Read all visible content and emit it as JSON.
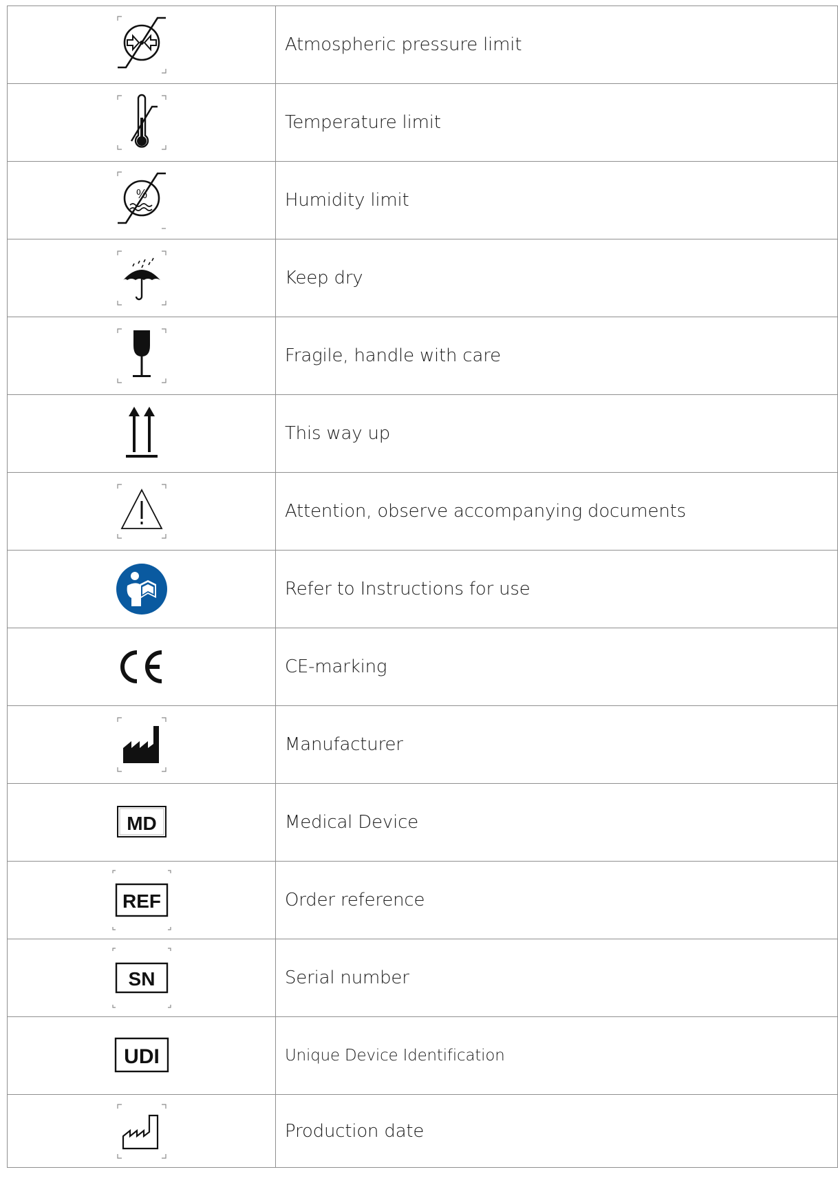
{
  "symbols": [
    {
      "icon": "atmospheric-pressure-limit-icon",
      "label": "Atmospheric pressure limit"
    },
    {
      "icon": "temperature-limit-icon",
      "label": "Temperature limit"
    },
    {
      "icon": "humidity-limit-icon",
      "label": "Humidity limit",
      "icon_text": "%"
    },
    {
      "icon": "keep-dry-icon",
      "label": "Keep dry"
    },
    {
      "icon": "fragile-icon",
      "label": "Fragile, handle with care"
    },
    {
      "icon": "this-way-up-icon",
      "label": "This way up"
    },
    {
      "icon": "caution-icon",
      "label": "Attention, observe accompanying documents"
    },
    {
      "icon": "instructions-for-use-icon",
      "label": "Refer to Instructions for use"
    },
    {
      "icon": "ce-marking-icon",
      "label": "CE-marking",
      "icon_text": "CE"
    },
    {
      "icon": "manufacturer-icon",
      "label": "Manufacturer"
    },
    {
      "icon": "medical-device-icon",
      "label": "Medical Device",
      "icon_text": "MD"
    },
    {
      "icon": "order-reference-icon",
      "label": "Order reference",
      "icon_text": "REF"
    },
    {
      "icon": "serial-number-icon",
      "label": "Serial number",
      "icon_text": "SN"
    },
    {
      "icon": "udi-icon",
      "label": "Unique Device Identification",
      "icon_text": "UDI"
    },
    {
      "icon": "production-date-icon",
      "label": "Production date"
    }
  ],
  "colors": {
    "border": "#8f8f8f",
    "text": "#1a1a1a",
    "ifu_blue": "#0a5aa0"
  }
}
